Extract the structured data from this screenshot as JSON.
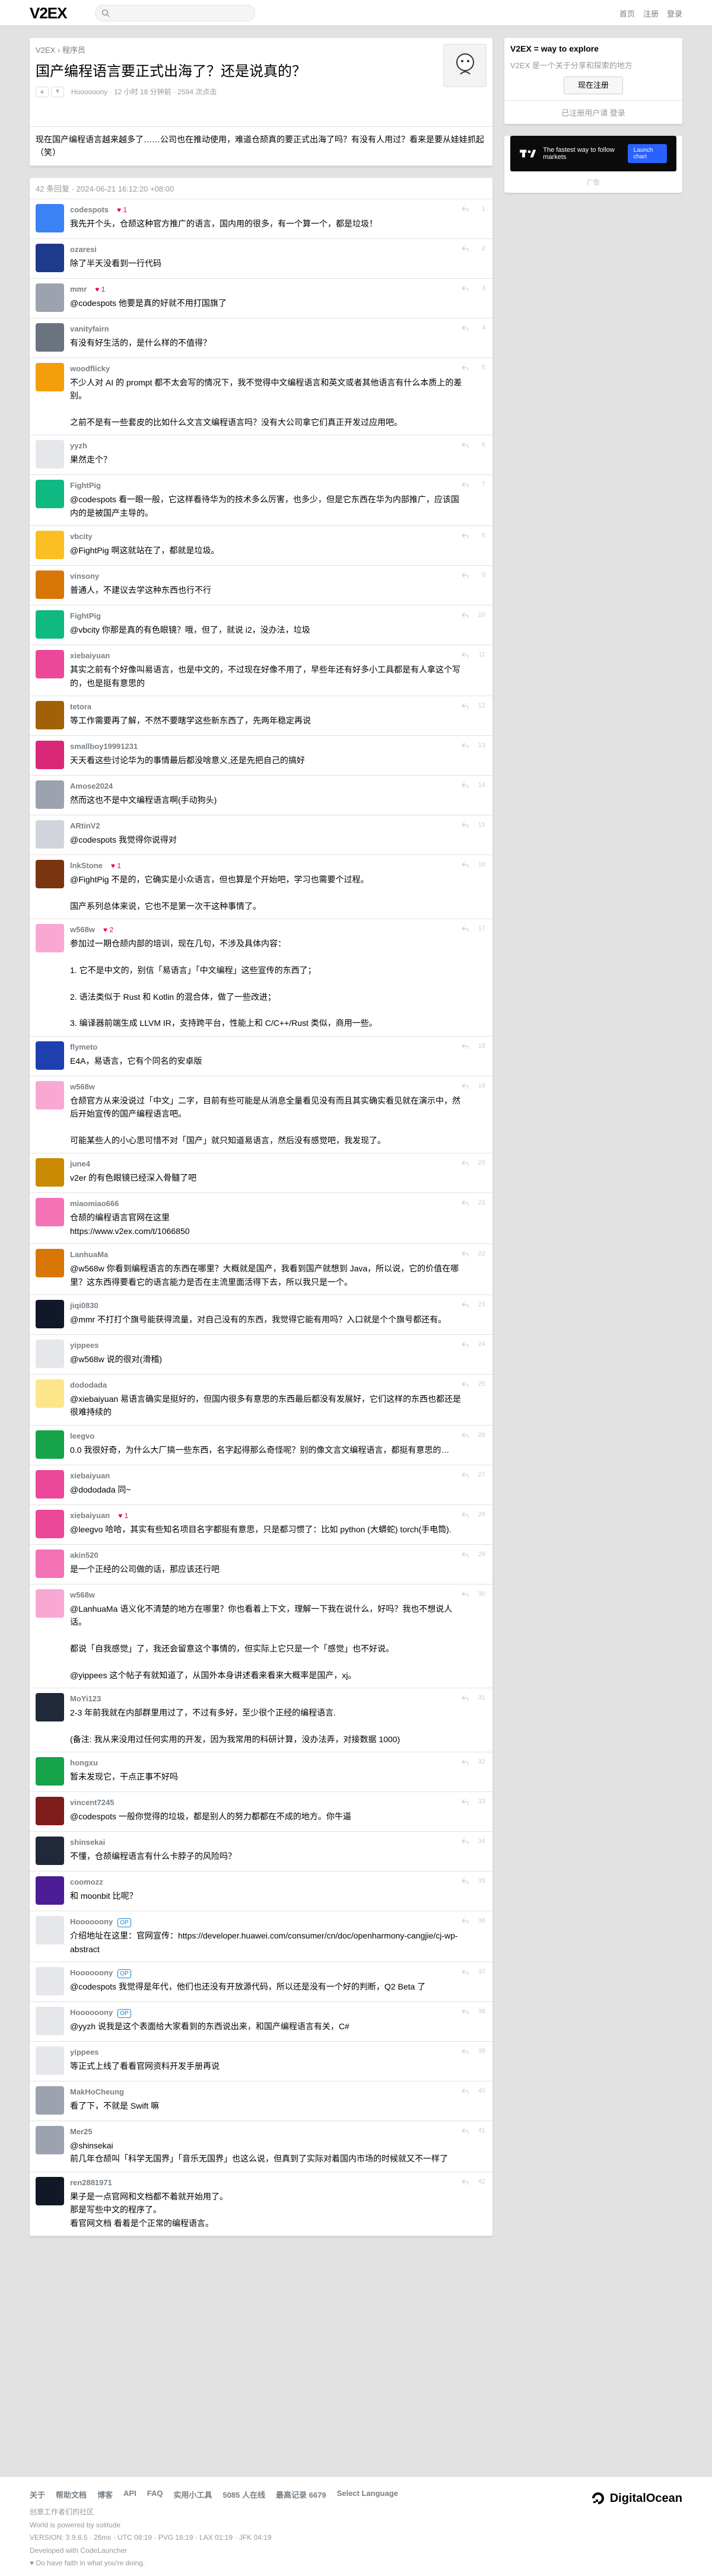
{
  "brand": {
    "logo": "V2EX"
  },
  "nav": {
    "home": "首页",
    "signup": "注册",
    "signin": "登录"
  },
  "topic": {
    "crumb_site": "V2EX",
    "crumb_sep": " › ",
    "crumb_node": "程序员",
    "title": "国产编程语言要正式出海了？还是说真的？",
    "meta": "Hoooooony · 12 小时 18 分钟前 · 2594 次点击",
    "content": "现在国产编程语言越来越多了……公司也在推动使用，难道仓颉真的要正式出海了吗？有没有人用过？看来是要从娃娃抓起（笑）"
  },
  "replies_head": "42 条回复 · 2024-06-21 16:12:20 +08:00",
  "replies": [
    {
      "u": "codespots",
      "t": "我先开个头，仓颉这种官方推广的语言，国内用的很多，有一个算一个，都是垃圾！",
      "h": "♥ 1",
      "c": "#3b82f6",
      "f": "1"
    },
    {
      "u": "ozaresi",
      "t": "除了半天没看到一行代码",
      "h": "",
      "c": "#1e3a8a",
      "f": "2"
    },
    {
      "u": "mmr",
      "t": "@codespots 他要是真的好就不用打国旗了",
      "h": "♥ 1",
      "c": "#9ca3af",
      "f": "3"
    },
    {
      "u": "vanityfairn",
      "t": "有没有好生活的，是什么样的不值得？",
      "h": "",
      "c": "#6b7280",
      "f": "4"
    },
    {
      "u": "woodflicky",
      "t": "不少人对 AI 的 prompt 都不太会写的情况下，我不觉得中文编程语言和英文或者其他语言有什么本质上的差别。\n\n之前不是有一些套皮的比如什么文言文编程语言吗？没有大公司拿它们真正开发过应用吧。",
      "h": "",
      "c": "#f59e0b",
      "f": "5"
    },
    {
      "u": "yyzh",
      "t": "果然走个？",
      "h": "",
      "c": "#e5e7eb",
      "f": "6"
    },
    {
      "u": "FightPig",
      "t": "@codespots 看一眼一般，它这样看待华为的技术多么厉害，也多少，但是它东西在华为内部推广，应该国内的是被国产主导的。",
      "h": "",
      "c": "#10b981",
      "f": "7"
    },
    {
      "u": "vbcity",
      "t": "@FightPig 啊这就站在了，都就是垃圾。",
      "h": "",
      "c": "#fbbf24",
      "f": "8"
    },
    {
      "u": "vinsony",
      "t": "普通人，不建议去学这种东西也行不行",
      "h": "",
      "c": "#d97706",
      "f": "9"
    },
    {
      "u": "FightPig",
      "t": "@vbcity 你那是真的有色眼镜？哦，但了，就说 i2，没办法，垃圾",
      "h": "",
      "c": "#10b981",
      "f": "10"
    },
    {
      "u": "xiebaiyuan",
      "t": "其实之前有个好像叫易语言，也是中文的，不过现在好像不用了，早些年还有好多小工具都是有人拿这个写的，也是挺有意思的",
      "h": "",
      "c": "#ec4899",
      "f": "11"
    },
    {
      "u": "tetora",
      "t": "等工作需要再了解，不然不要瞎学这些新东西了，先两年稳定再说",
      "h": "",
      "c": "#a16207",
      "f": "12"
    },
    {
      "u": "smallboy19991231",
      "t": "天天看这些讨论华为的事情最后都没啥意义,还是先把自己的搞好",
      "h": "",
      "c": "#db2777",
      "f": "13"
    },
    {
      "u": "Amose2024",
      "t": "然而这也不是中文编程语言啊(手动狗头)",
      "h": "",
      "c": "#9ca3af",
      "f": "14"
    },
    {
      "u": "ARtinV2",
      "t": "@codespots 我觉得你说得对",
      "h": "",
      "c": "#d1d5db",
      "f": "15"
    },
    {
      "u": "lnkStone",
      "t": "@FightPig 不是的，它确实是小众语言，但也算是个开始吧，学习也需要个过程。\n\n国产系列总体来说，它也不是第一次干这种事情了。",
      "h": "♥ 1",
      "c": "#78350f",
      "f": "16"
    },
    {
      "u": "w568w",
      "t": "参加过一期仓颉内部的培训，现在几句，不涉及具体内容：\n\n1. 它不是中文的，别信「易语言」「中文编程」这些宣传的东西了；\n\n2. 语法类似于 Rust 和 Kotlin 的混合体，做了一些改进；\n\n3. 编译器前端生成 LLVM IR，支持跨平台，性能上和 C/C++/Rust 类似，商用一些。",
      "h": "♥ 2",
      "c": "#f9a8d4",
      "f": "17"
    },
    {
      "u": "flymeto",
      "t": "E4A，易语言，它有个同名的安卓版",
      "h": "",
      "c": "#1e40af",
      "f": "18"
    },
    {
      "u": "w568w",
      "t": "仓颉官方从来没说过「中文」二字，目前有些可能是从消息全量看见没有而且其实确实看见就在演示中，然后开始宣传的国产编程语言吧。\n\n可能某些人的小心思可惜不对「国产」就只知道易语言，然后没有感觉吧，我发现了。",
      "h": "",
      "c": "#f9a8d4",
      "f": "19"
    },
    {
      "u": "june4",
      "t": "v2er 的有色眼镜已经深入骨髓了吧",
      "h": "",
      "c": "#ca8a04",
      "f": "20"
    },
    {
      "u": "miaomiao666",
      "t": "仓颉的编程语言官网在这里\nhttps://www.v2ex.com/t/1066850",
      "h": "",
      "c": "#f472b6",
      "f": "21"
    },
    {
      "u": "LanhuaMa",
      "t": "@w568w 你看到编程语言的东西在哪里？大概就是国产，我看到国产就想到 Java，所以说，它的价值在哪里？这东西得要看它的语言能力是否在主流里面活得下去，所以我只是一个。",
      "h": "",
      "c": "#d97706",
      "f": "22"
    },
    {
      "u": "jiqi0830",
      "t": "@mmr 不打打个旗号能获得流量，对自己没有的东西，我觉得它能有用吗？入口就是个个旗号都还有。",
      "h": "",
      "c": "#111827",
      "f": "23"
    },
    {
      "u": "yippees",
      "t": "@w568w 说的很对(滑稽)",
      "h": "",
      "c": "#e5e7eb",
      "f": "24"
    },
    {
      "u": "dododada",
      "t": "@xiebaiyuan 易语言确实是挺好的，但国内很多有意思的东西最后都没有发展好，它们这样的东西也都还是很难持续的",
      "h": "",
      "c": "#fde68a",
      "f": "25"
    },
    {
      "u": "leegvo",
      "t": "0.0 我很好奇，为什么大厂搞一些东西，名字起得那么奇怪呢？别的像文言文编程语言，都挺有意思的…",
      "h": "",
      "c": "#16a34a",
      "f": "26"
    },
    {
      "u": "xiebaiyuan",
      "t": "@dododada 同~",
      "h": "",
      "c": "#ec4899",
      "f": "27"
    },
    {
      "u": "xiebaiyuan",
      "t": "@leegvo 哈哈，其实有些知名项目名字都挺有意思，只是都习惯了：比如 python (大蟒蛇) torch(手电筒).",
      "h": "♥ 1",
      "c": "#ec4899",
      "f": "28"
    },
    {
      "u": "akin520",
      "t": "是一个正经的公司做的话，那应该还行吧",
      "h": "",
      "c": "#f472b6",
      "f": "29"
    },
    {
      "u": "w568w",
      "t": "@LanhuaMa 语义化不清楚的地方在哪里？你也看着上下文，理解一下我在说什么，好吗？我也不想说人话。\n\n都说「自我感觉」了，我还会留意这个事情的，但实际上它只是一个「感觉」也不好说。\n\n@yippees 这个帖子有就知道了，从国外本身讲述看来看来大概率是国产，xj。",
      "h": "",
      "c": "#f9a8d4",
      "f": "30"
    },
    {
      "u": "MoYi123",
      "t": "2-3 年前我就在内部群里用过了，不过有多好，至少很个正经的编程语言.\n\n(备注: 我从来没用过任何实用的开发，因为我常用的科研计算，没办法弄，对接数据 1000)",
      "h": "",
      "c": "#1f2937",
      "f": "31"
    },
    {
      "u": "hongxu",
      "t": "暂未发现它，干点正事不好吗",
      "h": "",
      "c": "#16a34a",
      "f": "32"
    },
    {
      "u": "vincent7245",
      "t": "@codespots 一般你觉得的垃圾，都是别人的努力都都在不成的地方。你牛逼",
      "h": "",
      "c": "#7f1d1d",
      "f": "33"
    },
    {
      "u": "shinsekai",
      "t": "不懂，仓颉编程语言有什么卡脖子的风险吗？",
      "h": "",
      "c": "#1f2937",
      "f": "34"
    },
    {
      "u": "coomozz",
      "t": "和 moonbit 比呢？",
      "h": "",
      "c": "#4c1d95",
      "f": "35"
    },
    {
      "u": "Hoooooony",
      "t": "介绍地址在这里：官网宣传：https://developer.huawei.com/consumer/cn/doc/openharmony-cangjie/cj-wp-abstract",
      "h": "",
      "c": "#e5e7eb",
      "f": "36",
      "op": "OP"
    },
    {
      "u": "Hoooooony",
      "t": "@codespots 我觉得是年代，他们也还没有开放源代码，所以还是没有一个好的判断，Q2 Beta 了",
      "h": "",
      "c": "#e5e7eb",
      "f": "37",
      "op": "OP"
    },
    {
      "u": "Hoooooony",
      "t": "@yyzh 说我是这个表面给大家看到的东西说出来，和国产编程语言有关，C#",
      "h": "",
      "c": "#e5e7eb",
      "f": "38",
      "op": "OP"
    },
    {
      "u": "yippees",
      "t": "等正式上线了看看官网资料开发手册再说",
      "h": "",
      "c": "#e5e7eb",
      "f": "39"
    },
    {
      "u": "MakHoCheung",
      "t": "看了下，不就是 Swift 嘛",
      "h": "",
      "c": "#9ca3af",
      "f": "40"
    },
    {
      "u": "Mer25",
      "t": "@shinsekai\n前几年仓颉叫「科学无国界」「音乐无国界」也这么说，但真到了实际对着国内市场的时候就又不一样了",
      "h": "",
      "c": "#9ca3af",
      "f": "41"
    },
    {
      "u": "ren2881971",
      "t": "果子是一点官网和文档都不着就开始用了。\n那是写些中文的程序了。\n看官网文档 看着是个正常的编程语言。",
      "h": "",
      "c": "#111827",
      "f": "42"
    }
  ],
  "sidebar": {
    "title": "V2EX = way to explore",
    "sub": "V2EX 是一个关于分享和探索的地方",
    "signup": "现在注册",
    "signin_hint": "已注册用户请 登录",
    "ad_text": "The fastest way to follow markets",
    "ad_btn": "Launch chart",
    "ad_label": "广告"
  },
  "footer": {
    "links": [
      "关于",
      "帮助文档",
      "博客",
      "API",
      "FAQ",
      "实用小工具",
      "5085 人在线",
      "最高记录 6679",
      "Select Language"
    ],
    "line1": "创意工作者们的社区",
    "line2": "World is powered by solitude",
    "line3": "VERSION: 3.9.8.5 · 26ms · UTC 08:19 · PVG 16:19 · LAX 01:19 · JFK 04:19",
    "line4": "Developed with CodeLauncher",
    "line5": "♥ Do have faith in what you're doing.",
    "do_logo": "DigitalOcean"
  }
}
